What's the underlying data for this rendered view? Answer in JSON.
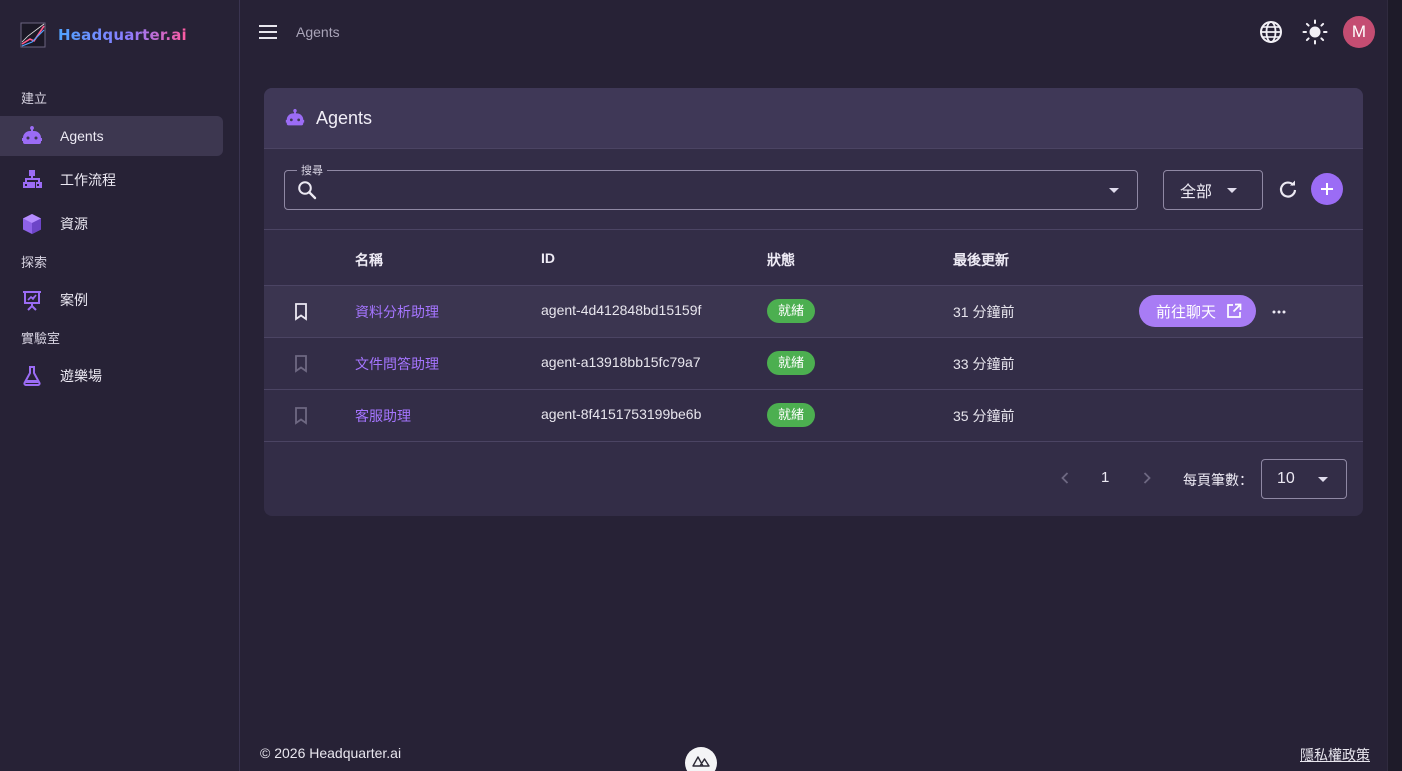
{
  "brand": {
    "name": "Headquarter.ai"
  },
  "sidebar": {
    "sections": [
      {
        "label": "建立"
      },
      {
        "label": "探索"
      },
      {
        "label": "實驗室"
      }
    ],
    "items": [
      {
        "label": "Agents",
        "icon": "robot-icon",
        "active": true
      },
      {
        "label": "工作流程",
        "icon": "sitemap-icon"
      },
      {
        "label": "資源",
        "icon": "cube-icon"
      },
      {
        "label": "案例",
        "icon": "presentation-icon"
      },
      {
        "label": "遊樂場",
        "icon": "flask-icon"
      }
    ]
  },
  "topbar": {
    "breadcrumb": "Agents",
    "avatar_initial": "M"
  },
  "card": {
    "title": "Agents",
    "search": {
      "legend": "搜尋",
      "value": ""
    },
    "filter": {
      "selected": "全部"
    }
  },
  "table": {
    "headers": {
      "name": "名稱",
      "id": "ID",
      "status": "狀態",
      "updated": "最後更新"
    },
    "rows": [
      {
        "name": "資料分析助理",
        "id": "agent-4d412848bd15159f",
        "status": "就緒",
        "updated": "31 分鐘前",
        "bookmarked": true,
        "action": "前往聊天"
      },
      {
        "name": "文件問答助理",
        "id": "agent-a13918bb15fc79a7",
        "status": "就緒",
        "updated": "33 分鐘前",
        "bookmarked": false
      },
      {
        "name": "客服助理",
        "id": "agent-8f4151753199be6b",
        "status": "就緒",
        "updated": "35 分鐘前",
        "bookmarked": false
      }
    ]
  },
  "pagination": {
    "page": "1",
    "per_page_label": "每頁筆數：",
    "per_page": "10"
  },
  "footer": {
    "copyright": "© 2026 Headquarter.ai",
    "privacy": "隱私權政策"
  },
  "colors": {
    "accent": "#a575ff",
    "button": "#a87cf5",
    "status_ready": "#4caf50",
    "avatar": "#c44d72"
  }
}
